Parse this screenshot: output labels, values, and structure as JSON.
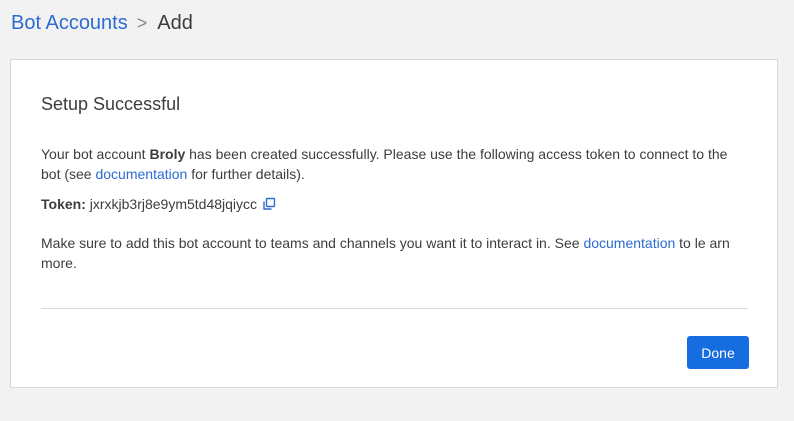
{
  "breadcrumb": {
    "parent": "Bot Accounts",
    "separator": ">",
    "current": "Add"
  },
  "card": {
    "title": "Setup Successful",
    "success_message": {
      "prefix": "Your bot account ",
      "bot_name": "Broly",
      "middle": " has been created successfully. Please use the following access token to connect to the bot (see ",
      "link_text": "documentation",
      "suffix": " for further details)."
    },
    "token": {
      "label": "Token:",
      "value": "jxrxkjb3rj8e9ym5td48jqiycc",
      "copy_icon": "copy-icon"
    },
    "teams_message": {
      "prefix": "Make sure to add this bot account to teams and channels you want it to interact in. See ",
      "link_text": "documentation",
      "suffix": " to le arn more."
    },
    "done_label": "Done"
  },
  "colors": {
    "link": "#2d6bd1",
    "primary_button": "#166de0",
    "background": "#f2f2f2",
    "card": "#ffffff"
  }
}
